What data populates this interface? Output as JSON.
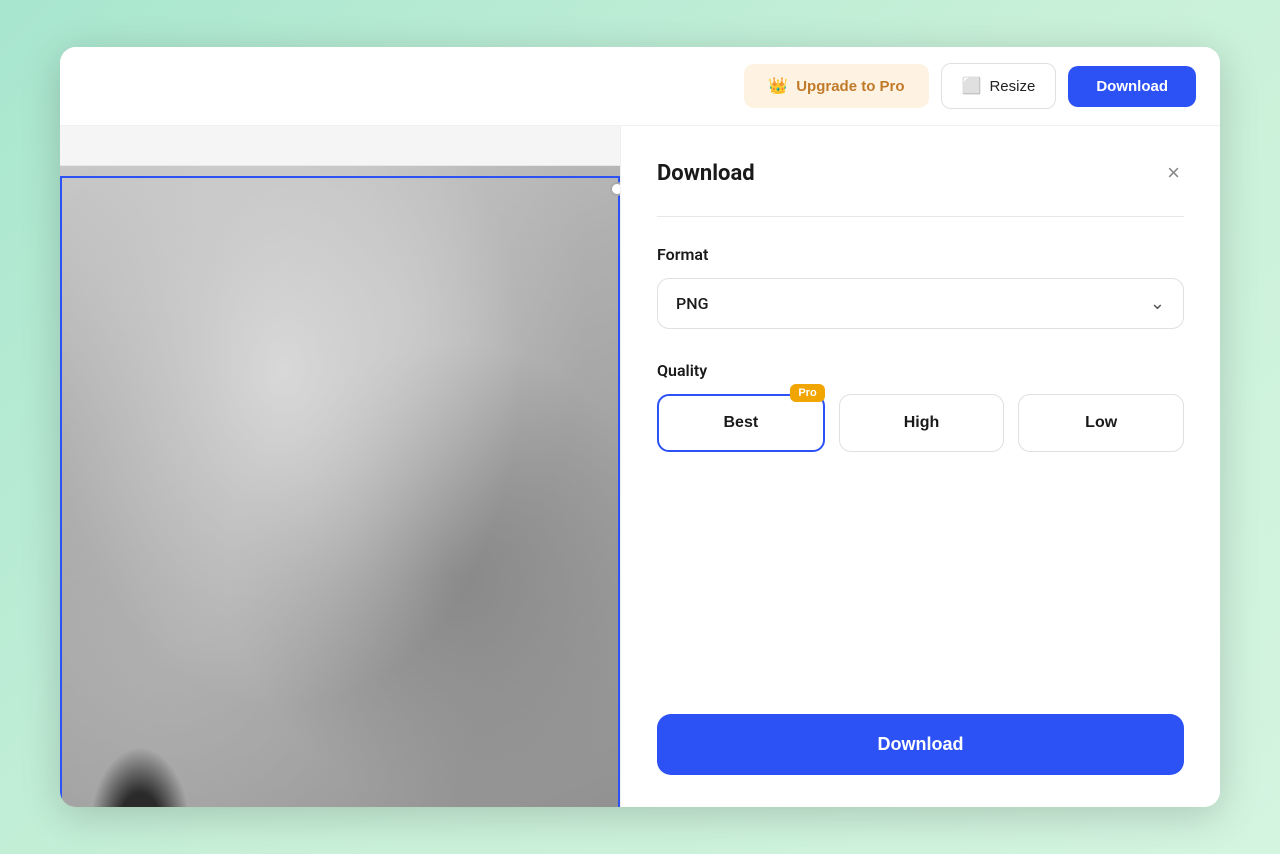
{
  "toolbar": {
    "upgrade_label": "Upgrade to Pro",
    "resize_label": "Resize",
    "download_top_label": "Download",
    "crown_icon": "👑"
  },
  "panel": {
    "title": "Download",
    "close_icon": "×",
    "format_section_label": "Format",
    "format_value": "PNG",
    "quality_section_label": "Quality",
    "quality_options": [
      {
        "label": "Best",
        "selected": true,
        "pro": true,
        "pro_badge": "Pro"
      },
      {
        "label": "High",
        "selected": false,
        "pro": false
      },
      {
        "label": "Low",
        "selected": false,
        "pro": false
      }
    ],
    "download_btn_label": "Download"
  },
  "colors": {
    "blue": "#2c52f5",
    "upgrade_bg": "#fef3e2",
    "upgrade_text": "#c07a2a",
    "pro_badge": "#f0a500"
  }
}
